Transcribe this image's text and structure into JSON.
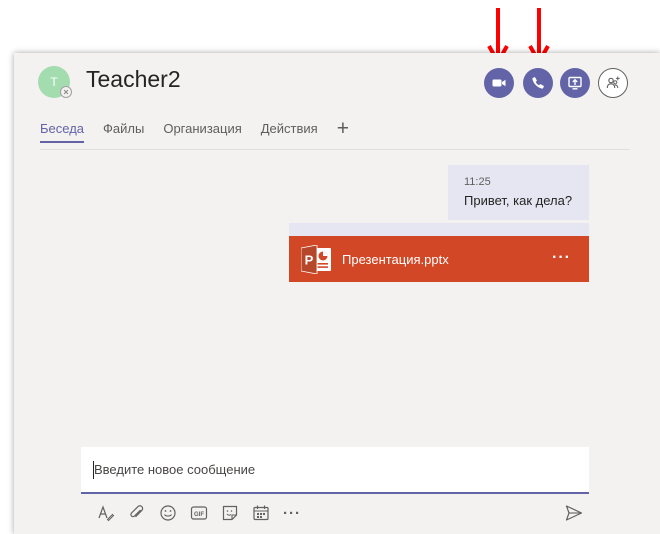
{
  "contact": {
    "name": "Teacher2",
    "initial": "T"
  },
  "tabs": [
    {
      "label": "Беседа",
      "active": true
    },
    {
      "label": "Файлы",
      "active": false
    },
    {
      "label": "Организация",
      "active": false
    },
    {
      "label": "Действия",
      "active": false
    }
  ],
  "tab_add_symbol": "+",
  "header_actions": [
    {
      "icon": "video-camera-icon",
      "function": "video-call"
    },
    {
      "icon": "phone-icon",
      "function": "audio-call"
    },
    {
      "icon": "screen-share-icon",
      "function": "share-screen"
    },
    {
      "icon": "add-people-icon",
      "function": "add-people"
    }
  ],
  "message": {
    "time": "11:25",
    "text": "Привет, как дела?"
  },
  "attachment": {
    "file_name": "Презентация.pptx",
    "more_symbol": "···",
    "icon_letter": "P"
  },
  "compose": {
    "placeholder": "Введите новое сообщение",
    "value": ""
  },
  "toolbar_more_symbol": "···",
  "colors": {
    "accent": "#6264a7",
    "window_bg": "#f3f2f1",
    "message_bubble": "#e6e6f2",
    "powerpoint": "#d24726",
    "annotation_arrow": "#ff0000",
    "avatar": "#a3dcae"
  }
}
